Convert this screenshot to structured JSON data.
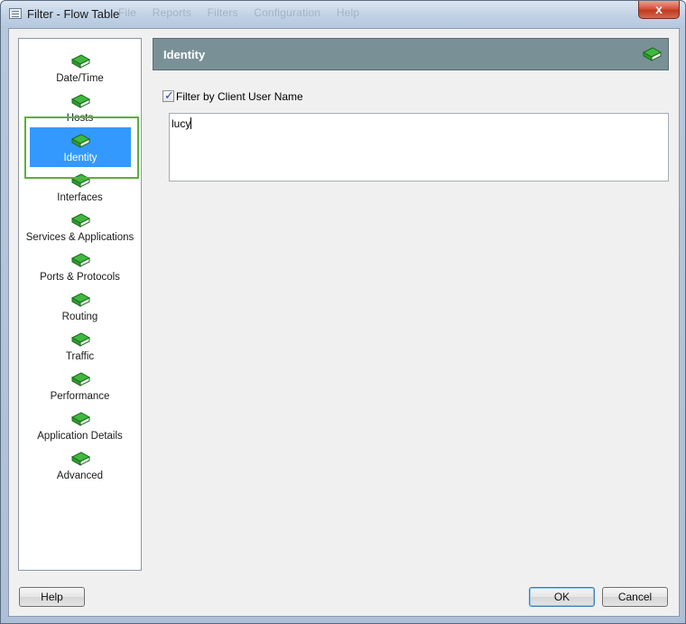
{
  "window": {
    "title": "Filter - Flow Table",
    "close_glyph": "x",
    "background_menu": [
      "File",
      "Reports",
      "Filters",
      "Configuration",
      "Help"
    ]
  },
  "nav": {
    "selected": "Identity",
    "items": [
      {
        "label": "Date/Time",
        "icon": "green-book-icon"
      },
      {
        "label": "Hosts",
        "icon": "green-book-icon"
      },
      {
        "label": "Identity",
        "icon": "green-book-icon"
      },
      {
        "label": "Interfaces",
        "icon": "green-book-icon"
      },
      {
        "label": "Services & Applications",
        "icon": "green-book-icon"
      },
      {
        "label": "Ports & Protocols",
        "icon": "green-book-icon"
      },
      {
        "label": "Routing",
        "icon": "green-book-icon"
      },
      {
        "label": "Traffic",
        "icon": "green-book-icon"
      },
      {
        "label": "Performance",
        "icon": "green-book-icon"
      },
      {
        "label": "Application Details",
        "icon": "green-book-icon"
      },
      {
        "label": "Advanced",
        "icon": "green-book-icon"
      }
    ]
  },
  "panel": {
    "title": "Identity",
    "checkbox_label": "Filter by Client User Name",
    "checkbox_checked": true,
    "user_names_value": "lucy"
  },
  "buttons": {
    "help": "Help",
    "ok": "OK",
    "cancel": "Cancel"
  },
  "colors": {
    "header_bar": "#7a9097",
    "selection": "#3399ff",
    "selection_outline": "#5fae3e",
    "book_green": "#2e9a2e"
  }
}
